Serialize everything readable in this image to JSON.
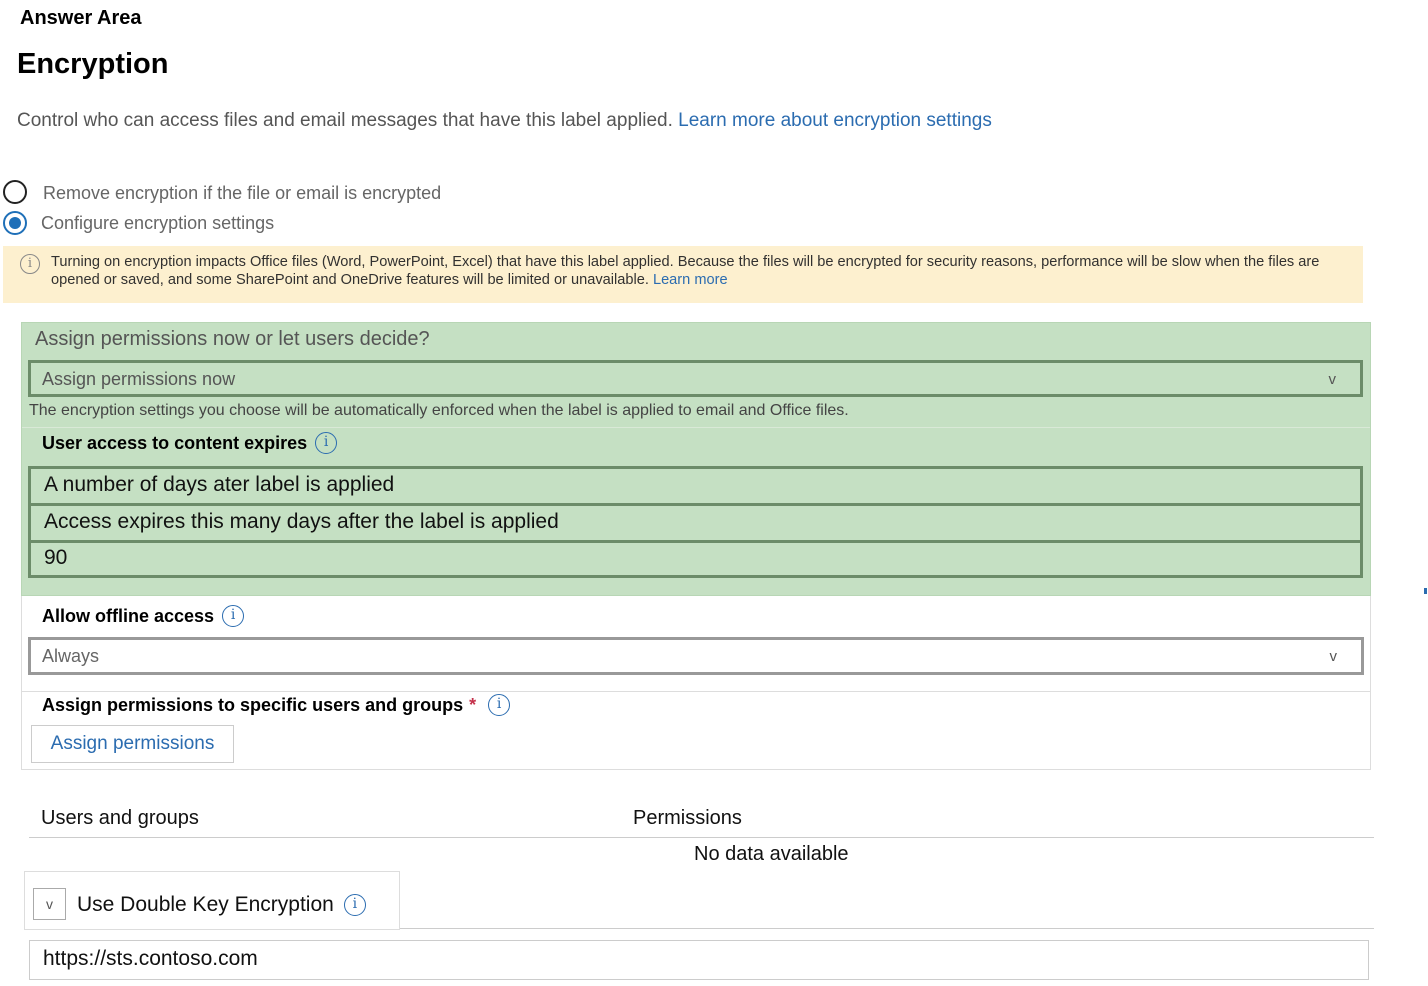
{
  "header": {
    "answer_area": "Answer Area",
    "title": "Encryption",
    "description": "Control who can access files and email messages that have this label applied.",
    "description_link": "Learn more about encryption settings"
  },
  "options": {
    "remove_label": "Remove encryption if the file or email is encrypted",
    "configure_label": "Configure encryption settings",
    "selected": "configure"
  },
  "warning": {
    "text": "Turning on encryption impacts Office files (Word, PowerPoint, Excel) that have this label applied. Because the files will be encrypted for security reasons, performance will be slow when the files are opened or saved, and some SharePoint and OneDrive features will be limited or unavailable.",
    "link": "Learn more"
  },
  "assign": {
    "question": "Assign permissions now or let users decide?",
    "selected": "Assign permissions now",
    "note": "The encryption settings you choose will be automatically enforced when the label is applied to email and Office files."
  },
  "expiry": {
    "label": "User access to content expires",
    "option": "A number of days ater label is applied",
    "days_label": "Access expires this many days after the label is applied",
    "days_value": "90"
  },
  "offline": {
    "label": "Allow offline access",
    "selected": "Always"
  },
  "permissions": {
    "label": "Assign permissions to specific users and groups",
    "required_mark": "*",
    "button": "Assign permissions"
  },
  "table": {
    "col_users": "Users and groups",
    "col_permissions": "Permissions",
    "empty": "No data available"
  },
  "dke": {
    "label": "Use Double Key Encryption",
    "url": "https://sts.contoso.com"
  },
  "icons": {
    "chevron": "v",
    "info": "i"
  },
  "colors": {
    "link": "#2b6cb0",
    "highlight_green": "#c5e0c3",
    "warning_bg": "#fdf0cf"
  }
}
